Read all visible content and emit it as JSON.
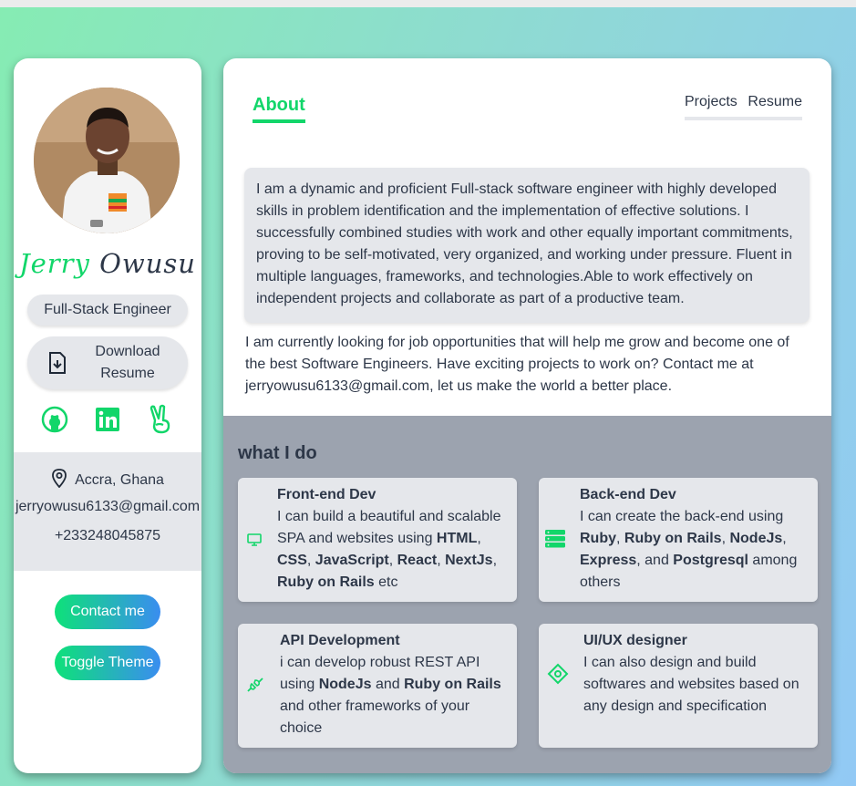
{
  "profile": {
    "first_name": "Jerry",
    "last_name": "Owusu",
    "role": "Full-Stack Engineer",
    "download_label": "Download Resume",
    "avatar_alt": "profile photo"
  },
  "socials": [
    {
      "icon": "github-icon"
    },
    {
      "icon": "linkedin-icon"
    },
    {
      "icon": "peace-hand-icon"
    }
  ],
  "contact": {
    "location": "Accra, Ghana",
    "email": "jerryowusu6133@gmail.com",
    "phone": "+233248045875"
  },
  "buttons": {
    "contact": "Contact me",
    "theme": "Toggle Theme"
  },
  "tabs": {
    "active": "About",
    "projects": "Projects",
    "resume": "Resume"
  },
  "about": {
    "intro": "I am a dynamic and proficient Full-stack software engineer with highly developed skills in problem identification and the implementation of effective solutions. I successfully combined studies with work and other equally important commitments, proving to be self-motivated, very organized, and working under pressure. Fluent in multiple languages, frameworks, and technologies.Able to work effectively on independent projects and collaborate as part of a productive team.",
    "looking": "I am currently looking for job opportunities that will help me grow and become one of the best Software Engineers. Have exciting projects to work on? Contact me at jerryowusu6133@gmail.com, let us make the world a better place."
  },
  "what_i_do": {
    "heading": "what I do",
    "services": [
      {
        "title": "Front-end Dev",
        "icon": "monitor-icon",
        "parts": [
          "I can build a beautiful and scalable SPA and websites using ",
          "HTML",
          ", ",
          "CSS",
          ", ",
          "JavaScript",
          ", ",
          "React",
          ", ",
          "NextJs",
          ", ",
          "Ruby on Rails",
          " etc"
        ]
      },
      {
        "title": "Back-end Dev",
        "icon": "server-icon",
        "parts": [
          "I can create the back-end using ",
          "Ruby",
          ", ",
          "Ruby on Rails",
          ", ",
          "NodeJs",
          ", ",
          "Express",
          ", and ",
          "Postgresql",
          " among others"
        ]
      },
      {
        "title": "API Development",
        "icon": "plug-icon",
        "parts": [
          "i can develop robust REST API using ",
          "NodeJs",
          " and ",
          "Ruby on Rails",
          " and other frameworks of your choice"
        ]
      },
      {
        "title": "UI/UX designer",
        "icon": "design-diamond-icon",
        "parts": [
          "I can also design and build softwares and websites based on any design and specification"
        ]
      }
    ]
  },
  "colors": {
    "accent": "#12d66a",
    "text": "#2d3748",
    "panel_gray": "#e5e7eb",
    "section_gray": "#9ca3af",
    "button_gradient_start": "#0ee179",
    "button_gradient_end": "#3a8df0"
  }
}
